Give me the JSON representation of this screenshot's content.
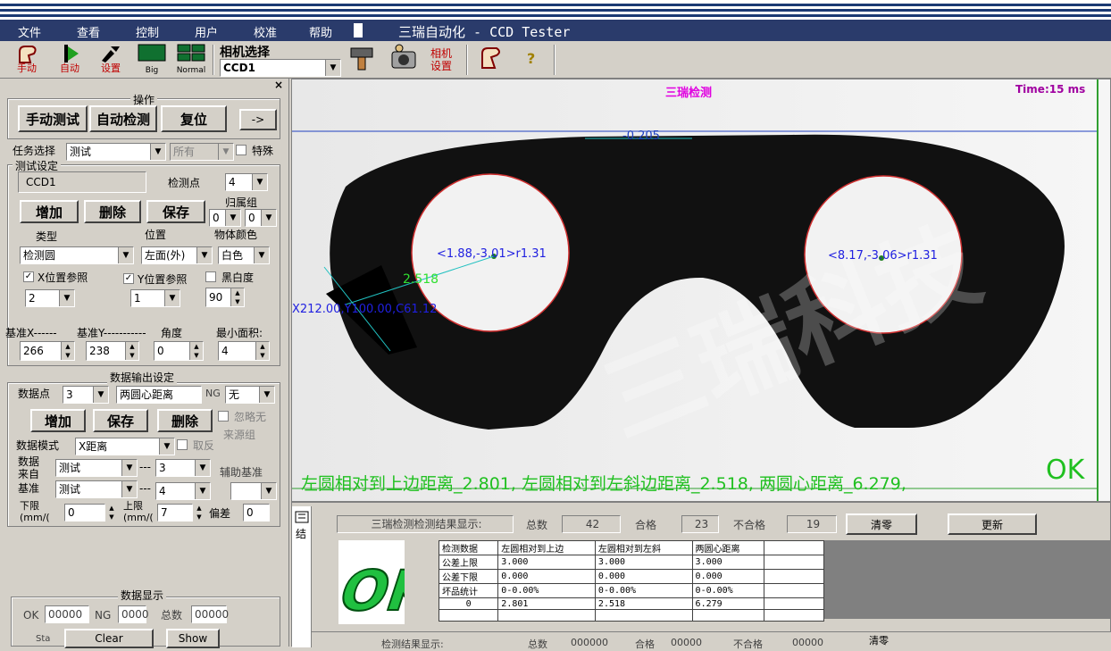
{
  "menu": [
    "文件",
    "查看",
    "控制",
    "用户",
    "校准",
    "帮助"
  ],
  "app_title": "三瑞自动化 - CCD Tester",
  "toolbar": {
    "manual": "手动",
    "auto": "自动",
    "settings": "设置",
    "big": "Big",
    "normal": "Normal",
    "camera_select_label": "相机选择",
    "camera_value": "CCD1",
    "camera_settings": "相机\n设置"
  },
  "operation": {
    "title": "操作",
    "manual_test": "手动测试",
    "auto_detect": "自动检测",
    "reset": "复位",
    "arrow": "->",
    "task_label": "任务选择",
    "task_value": "测试",
    "all_value": "所有",
    "special_label": "特殊"
  },
  "test_settings": {
    "title": "测试设定",
    "camera": "CCD1",
    "points_label": "检测点",
    "points_value": "4",
    "group_label": "归属组",
    "group_a": "0",
    "group_b": "0",
    "add": "增加",
    "delete": "删除",
    "save": "保存",
    "type_label": "类型",
    "position_label": "位置",
    "color_label": "物体颜色",
    "type_value": "检测圆",
    "position_value": "左面(外)",
    "color_value": "白色",
    "x_ref_label": "X位置参照",
    "y_ref_label": "Y位置参照",
    "bw_label": "黑白度",
    "x_ref_value": "2",
    "y_ref_value": "1",
    "bw_value": "90",
    "base_x_label": "基准X------",
    "base_y_label": "基准Y-----------",
    "angle_label": "角度",
    "min_area_label": "最小面积:",
    "base_x": "266",
    "base_y": "238",
    "angle": "0",
    "min_area": "4"
  },
  "output_settings": {
    "title": "数据输出设定",
    "point_label": "数据点",
    "point_value": "3",
    "name_value": "两圆心距离",
    "ng_label": "NG",
    "ng_value": "无",
    "add": "增加",
    "save": "保存",
    "delete": "删除",
    "ignore_label": "忽略无",
    "source_label": "来源组",
    "mode_label": "数据模式",
    "mode_value": "X距离",
    "invert_label": "取反",
    "source_data_label": "数据\n来自",
    "source_data_value": "测试",
    "source_data_num": "3",
    "base_label": "基准",
    "base_value": "测试",
    "base_num": "4",
    "aux_label": "辅助基准",
    "lower_label": "下限\n(mm/(",
    "lower_value": "0",
    "upper_label": "上限\n(mm/(",
    "upper_value": "7",
    "offset_label": "偏差",
    "offset_value": "0"
  },
  "data_display": {
    "title": "数据显示",
    "ok_label": "OK",
    "ok_value": "00000",
    "ng_label": "NG",
    "ng_value": "0000",
    "total_label": "总数",
    "total_value": "00000",
    "sta_label": "Sta",
    "clear": "Clear",
    "show": "Show"
  },
  "image": {
    "header": "三瑞检测",
    "time": "Time:15 ms",
    "top_measure": "-0.205",
    "left_circle": "<1.88,-3.01>r1.31",
    "right_circle": "<8.17,-3.06>r1.31",
    "slant_measure": "2.518",
    "coord": "X212.00,Y100.00,C61.12",
    "result_text": "左圆相对到上边距离_2.801, 左圆相对到左斜边距离_2.518, 两圆心距离_6.279,",
    "ok": "OK",
    "watermark": "三瑞科技"
  },
  "results": {
    "tab": "结",
    "title": "三瑞检测检测结果显示:",
    "total_label": "总数",
    "total": "42",
    "pass_label": "合格",
    "pass": "23",
    "fail_label": "不合格",
    "fail": "19",
    "clear": "清零",
    "update": "更新",
    "ok_big": "OK",
    "table": {
      "headers": [
        "检测数据",
        "左圆相对到上边",
        "左圆相对到左斜",
        "两圆心距离"
      ],
      "rows": [
        [
          "公差上限",
          "3.000",
          "3.000",
          "3.000"
        ],
        [
          "公差下限",
          "0.000",
          "0.000",
          "0.000"
        ],
        [
          "坏品统计",
          "0-0.00%",
          "0-0.00%",
          "0-0.00%"
        ],
        [
          "0",
          "2.801",
          "2.518",
          "6.279"
        ]
      ]
    },
    "second_title": "检测结果显示:",
    "second_total_label": "总数",
    "second_total": "000000",
    "second_pass_label": "合格",
    "second_pass": "00000",
    "second_fail_label": "不合格",
    "second_fail": "00000",
    "second_clear": "清零"
  }
}
